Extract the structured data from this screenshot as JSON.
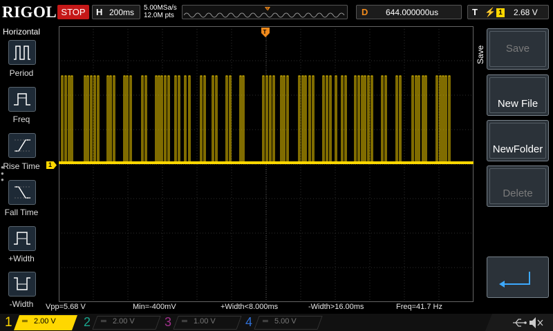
{
  "brand": "RIGOL",
  "run_state": "STOP",
  "horizontal": {
    "tag": "H",
    "timebase": "200ms"
  },
  "acquisition": {
    "sample_rate": "5.00MSa/s",
    "memory_depth": "12.0M pts"
  },
  "delay": {
    "tag": "D",
    "value": "644.000000us"
  },
  "trigger": {
    "tag": "T",
    "edge_icon": "rising-edge-icon",
    "source": "1",
    "level": "2.68 V"
  },
  "left_menu": {
    "title": "Horizontal",
    "items": [
      {
        "label": "Period",
        "icon": "period-icon"
      },
      {
        "label": "Freq",
        "icon": "frequency-icon"
      },
      {
        "label": "Rise Time",
        "icon": "rise-time-icon"
      },
      {
        "label": "Fall Time",
        "icon": "fall-time-icon"
      },
      {
        "label": "+Width",
        "icon": "positive-width-icon"
      },
      {
        "label": "-Width",
        "icon": "negative-width-icon"
      }
    ]
  },
  "soft_menu": {
    "title": "Save",
    "buttons": [
      {
        "label": "Save",
        "enabled": false
      },
      {
        "label": "New File",
        "enabled": true
      },
      {
        "label": "NewFolder",
        "enabled": true
      },
      {
        "label": "Delete",
        "enabled": false
      },
      {
        "label": "",
        "icon": "enter-icon",
        "enabled": true
      }
    ]
  },
  "markers": {
    "ch1": "1"
  },
  "measurements": [
    "Vpp=5.68 V",
    "Min=-400mV",
    "+Width<8.000ms",
    "-Width>16.00ms",
    "Freq=41.7 Hz"
  ],
  "channels": [
    {
      "num": "1",
      "scale": "2.00 V",
      "active": true,
      "color": "#ffd700"
    },
    {
      "num": "2",
      "scale": "2.00 V",
      "active": false,
      "color": "#1aa58e"
    },
    {
      "num": "3",
      "scale": "1.00 V",
      "active": false,
      "color": "#a0308c"
    },
    {
      "num": "4",
      "scale": "5.00 V",
      "active": false,
      "color": "#2f6fd6"
    }
  ],
  "status_icons": [
    "usb-icon",
    "speaker-muted-icon"
  ],
  "colors": {
    "trace": "#ffd700",
    "trigger_marker": "#f08a1c",
    "grid": "#3a3a3a",
    "stop": "#c51818"
  }
}
